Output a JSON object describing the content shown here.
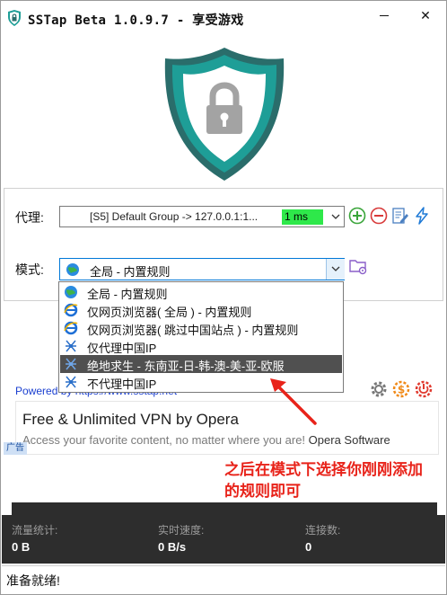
{
  "window": {
    "title": "SSTap Beta 1.0.9.7 - 享受游戏",
    "close_glyph": "✕"
  },
  "proxy": {
    "label": "代理:",
    "value": "[S5] Default Group -> 127.0.0.1:1...",
    "latency": "1 ms",
    "latency_color": "#2ee84a"
  },
  "mode": {
    "label": "模式:",
    "value": "全局 - 内置规则",
    "options": [
      {
        "label": "全局 - 内置规则",
        "icon": "globe-icon"
      },
      {
        "label": "仅网页浏览器( 全局 ) - 内置规则",
        "icon": "ie-icon"
      },
      {
        "label": "仅网页浏览器( 跳过中国站点 ) - 内置规则",
        "icon": "ie-icon"
      },
      {
        "label": "仅代理中国IP",
        "icon": "network-icon"
      },
      {
        "label": "绝地求生 - 东南亚-日-韩-澳-美-亚-欧服",
        "icon": "network-icon",
        "selected": true
      },
      {
        "label": "不代理中国IP",
        "icon": "network-icon"
      }
    ]
  },
  "powered": "Powered by https://www.sstap.net",
  "ad": {
    "title": "Free & Unlimited VPN by Opera",
    "subtitle": "Access your favorite content, no matter where you are!",
    "brand": "Opera Software",
    "tag": "广告"
  },
  "annotation": {
    "line1": "之后在模式下选择你刚刚添加",
    "line2": "的规则即可",
    "color": "#e8231a"
  },
  "stats": {
    "traffic_label": "流量统计:",
    "traffic_value": "0 B",
    "speed_label": "实时速度:",
    "speed_value": "0 B/s",
    "connections_label": "连接数:",
    "connections_value": "0"
  },
  "status": "准备就绪!",
  "colors": {
    "shield_teal": "#1e9e97",
    "shield_dark": "#2a6d6b",
    "stats_bg": "#2d2d2d"
  }
}
